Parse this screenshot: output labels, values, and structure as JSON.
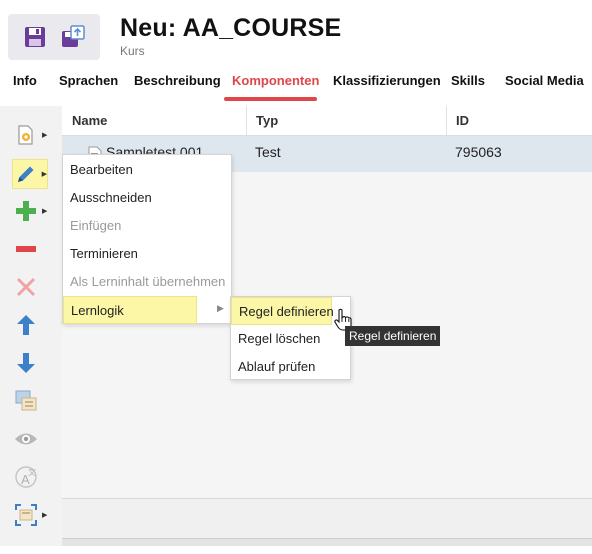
{
  "header": {
    "title": "Neu: AA_COURSE",
    "subtitle": "Kurs",
    "icons": [
      "save-icon",
      "save-copy-icon"
    ]
  },
  "tabs": [
    {
      "label": "Info",
      "active": false
    },
    {
      "label": "Sprachen",
      "active": false
    },
    {
      "label": "Beschreibung",
      "active": false
    },
    {
      "label": "Komponenten",
      "active": true
    },
    {
      "label": "Klassifizierungen",
      "active": false
    },
    {
      "label": "Skills",
      "active": false
    },
    {
      "label": "Social Media",
      "active": false
    }
  ],
  "toolbar": {
    "items": [
      "add-document-icon",
      "edit-pencil-icon",
      "add-plus-icon",
      "remove-minus-icon",
      "delete-x-icon",
      "move-up-icon",
      "move-down-icon",
      "copy-stack-icon",
      "preview-eye-icon",
      "translate-icon",
      "scan-icon"
    ]
  },
  "table": {
    "columns": [
      "Name",
      "Typ",
      "ID"
    ],
    "rows": [
      {
        "name": "Sampletest 001",
        "typ": "Test",
        "id": "795063"
      }
    ]
  },
  "context_menu": {
    "items": [
      {
        "label": "Bearbeiten",
        "disabled": false
      },
      {
        "label": "Ausschneiden",
        "disabled": false
      },
      {
        "label": "Einfügen",
        "disabled": true
      },
      {
        "label": "Terminieren",
        "disabled": false
      },
      {
        "label": "Als Lerninhalt übernehmen",
        "disabled": true
      },
      {
        "label": "Lernlogik",
        "disabled": false,
        "has_submenu": true
      }
    ]
  },
  "submenu": {
    "items": [
      {
        "label": "Regel definieren"
      },
      {
        "label": "Regel löschen"
      },
      {
        "label": "Ablauf prüfen"
      }
    ]
  },
  "tooltip": {
    "text": "Regel definieren"
  },
  "colors": {
    "accent": "#e0454a",
    "highlight": "#fbf7a6",
    "row_selected": "#dfe7ee",
    "save_purple": "#6a3d9a",
    "add_green": "#4caf50",
    "arrow_blue": "#3d7fc8"
  }
}
